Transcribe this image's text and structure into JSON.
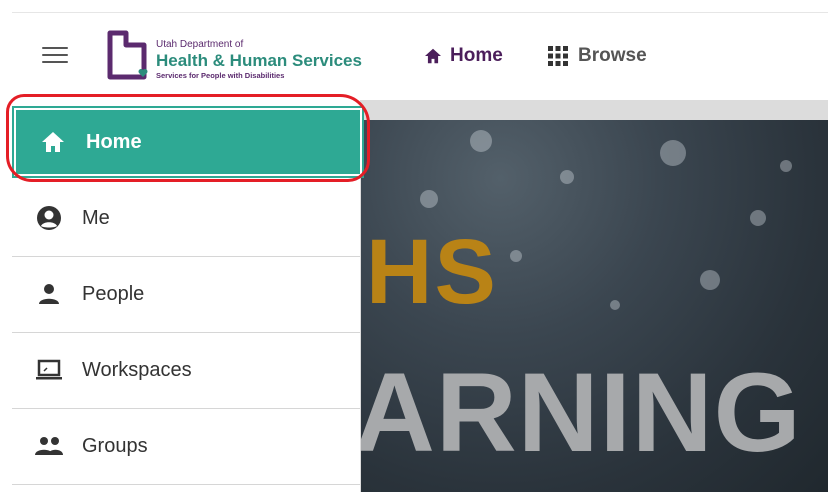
{
  "header": {
    "logo": {
      "line1": "Utah Department of",
      "line2": "Health & Human Services",
      "line3": "Services for People with Disabilities"
    },
    "nav": [
      {
        "label": "Home",
        "icon": "home-icon"
      },
      {
        "label": "Browse",
        "icon": "grid-icon"
      }
    ]
  },
  "menu": {
    "items": [
      {
        "label": "Home",
        "icon": "home-icon",
        "active": true
      },
      {
        "label": "Me",
        "icon": "account-circle-icon"
      },
      {
        "label": "People",
        "icon": "person-icon"
      },
      {
        "label": "Workspaces",
        "icon": "laptop-icon"
      },
      {
        "label": "Groups",
        "icon": "group-icon"
      }
    ]
  },
  "hero": {
    "line1": "HS",
    "line2": "ARNING"
  },
  "colors": {
    "brand_purple": "#4b1e5b",
    "brand_teal": "#2ea994",
    "highlight_red": "#e41e26",
    "hero_gold": "#b98316"
  }
}
